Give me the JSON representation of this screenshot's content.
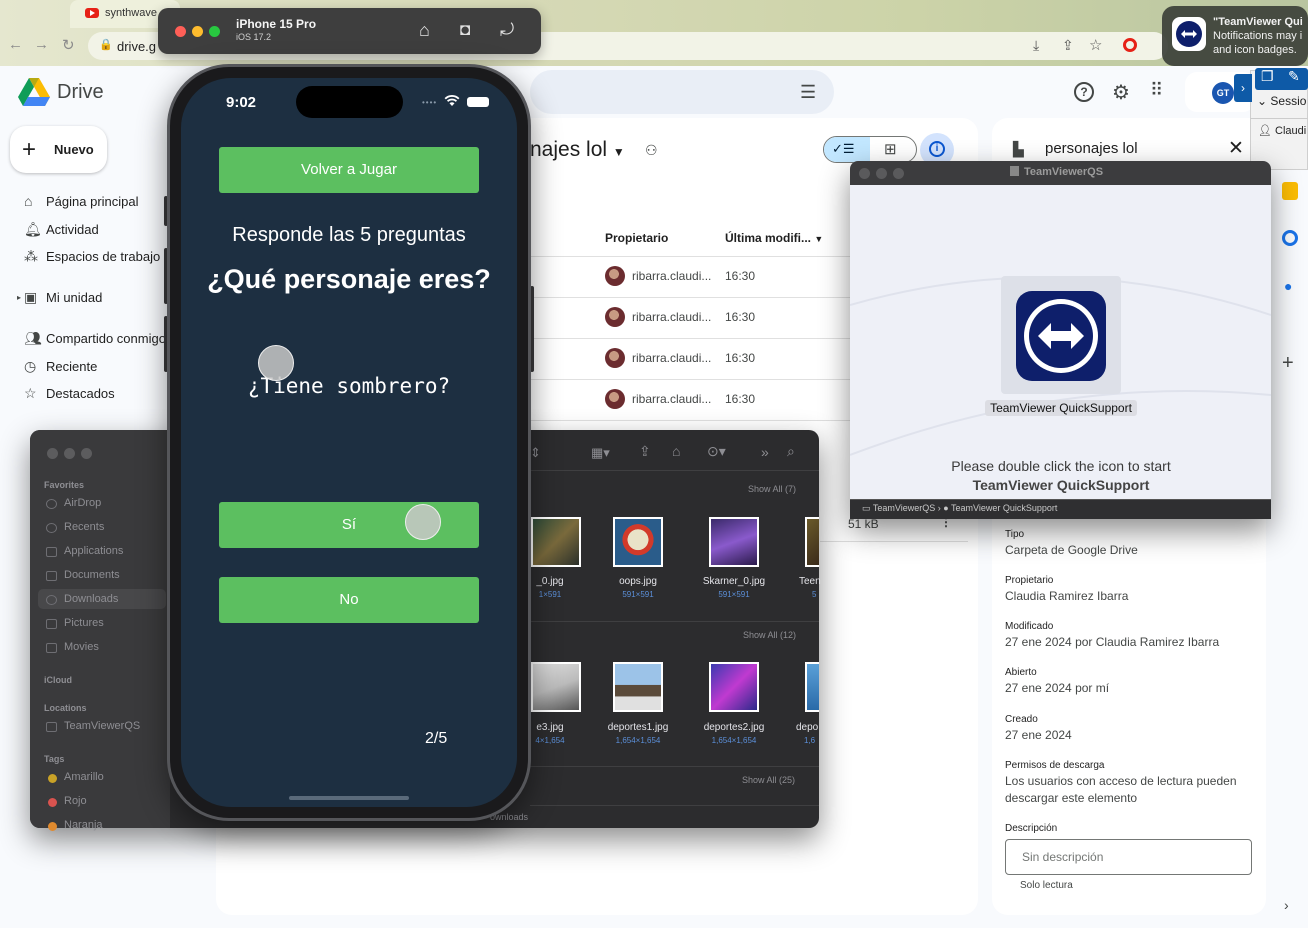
{
  "browser": {
    "tab_title": "synthwave",
    "url": "drive.g",
    "brand_color": "#e62117"
  },
  "notification": {
    "title": "\"TeamViewer Qui",
    "line1": "Notifications may i",
    "line2": "and icon badges."
  },
  "teamviewer_panel": {
    "session": "Sessio",
    "user": "Claudi"
  },
  "drive": {
    "app_name": "Drive",
    "new_button": "Nuevo",
    "nav": [
      {
        "label": "Página principal",
        "icon": "home-icon"
      },
      {
        "label": "Actividad",
        "icon": "bell-icon"
      },
      {
        "label": "Espacios de trabajo",
        "icon": "workspaces-icon"
      },
      {
        "label": "Mi unidad",
        "icon": "drive-icon"
      },
      {
        "label": "Compartido conmigo",
        "icon": "shared-icon"
      },
      {
        "label": "Reciente",
        "icon": "clock-icon"
      },
      {
        "label": "Destacados",
        "icon": "star-icon"
      }
    ],
    "folder_title": "najes lol",
    "columns": {
      "owner": "Propietario",
      "modified": "Última modifi..."
    },
    "rows": [
      {
        "owner": "ribarra.claudi...",
        "modified": "16:30"
      },
      {
        "owner": "ribarra.claudi...",
        "modified": "16:30"
      },
      {
        "owner": "ribarra.claudi...",
        "modified": "16:30"
      },
      {
        "owner": "ribarra.claudi...",
        "modified": "16:30"
      }
    ],
    "size_partial": "51 kB",
    "details": {
      "folder_name": "personajes lol",
      "type_label": "Tipo",
      "type_value": "Carpeta de Google Drive",
      "owner_label": "Propietario",
      "owner_value": "Claudia Ramirez Ibarra",
      "modified_label": "Modificado",
      "modified_value": "27 ene 2024 por Claudia Ramirez Ibarra",
      "opened_label": "Abierto",
      "opened_value": "27 ene 2024 por mí",
      "created_label": "Creado",
      "created_value": "27 ene 2024",
      "perm_label": "Permisos de descarga",
      "perm_value": "Los usuarios con acceso de lectura pueden descargar este elemento",
      "desc_label": "Descripción",
      "desc_placeholder": "Sin descripción",
      "readonly": "Solo lectura"
    }
  },
  "finder": {
    "favorites_header": "Favorites",
    "favorites": [
      "AirDrop",
      "Recents",
      "Applications",
      "Documents",
      "Downloads",
      "Pictures",
      "Movies"
    ],
    "icloud_header": "iCloud",
    "locations_header": "Locations",
    "locations": [
      "TeamViewerQS"
    ],
    "tags_header": "Tags",
    "tags": [
      {
        "label": "Amarillo",
        "color": "#c9a227"
      },
      {
        "label": "Rojo",
        "color": "#d9534f"
      },
      {
        "label": "Naranja",
        "color": "#e08a2e"
      }
    ],
    "show_all": [
      "Show All (7)",
      "Show All (12)",
      "Show All (25)"
    ],
    "row1": [
      {
        "name": "_0.jpg",
        "dim": "1×591"
      },
      {
        "name": "oops.jpg",
        "dim": "591×591"
      },
      {
        "name": "Skarner_0.jpg",
        "dim": "591×591"
      },
      {
        "name": "Teen",
        "dim": "5"
      }
    ],
    "row2": [
      {
        "name": "e3.jpg",
        "dim": "4×1,654"
      },
      {
        "name": "deportes1.jpg",
        "dim": "1,654×1,654"
      },
      {
        "name": "deportes2.jpg",
        "dim": "1,654×1,654"
      },
      {
        "name": "depo",
        "dim": "1,6"
      }
    ],
    "status": "ownloads"
  },
  "teamviewer": {
    "window_title": "TeamViewerQS",
    "app_label": "TeamViewer QuickSupport",
    "message_line1": "Please double click the icon to start",
    "message_line2": "TeamViewer QuickSupport",
    "path_1": "TeamViewerQS",
    "path_2": "TeamViewer QuickSupport"
  },
  "simulator": {
    "device": "iPhone 15 Pro",
    "os": "iOS 17.2",
    "time": "9:02",
    "replay_button": "Volver a Jugar",
    "subtitle": "Responde las 5 preguntas",
    "question": "¿Qué personaje eres?",
    "clue": "¿Tiene sombrero?",
    "yes_button": "Sí",
    "no_button": "No",
    "score": "2/5",
    "button_color": "#5cbf60",
    "screen_color": "#1d2f41"
  }
}
